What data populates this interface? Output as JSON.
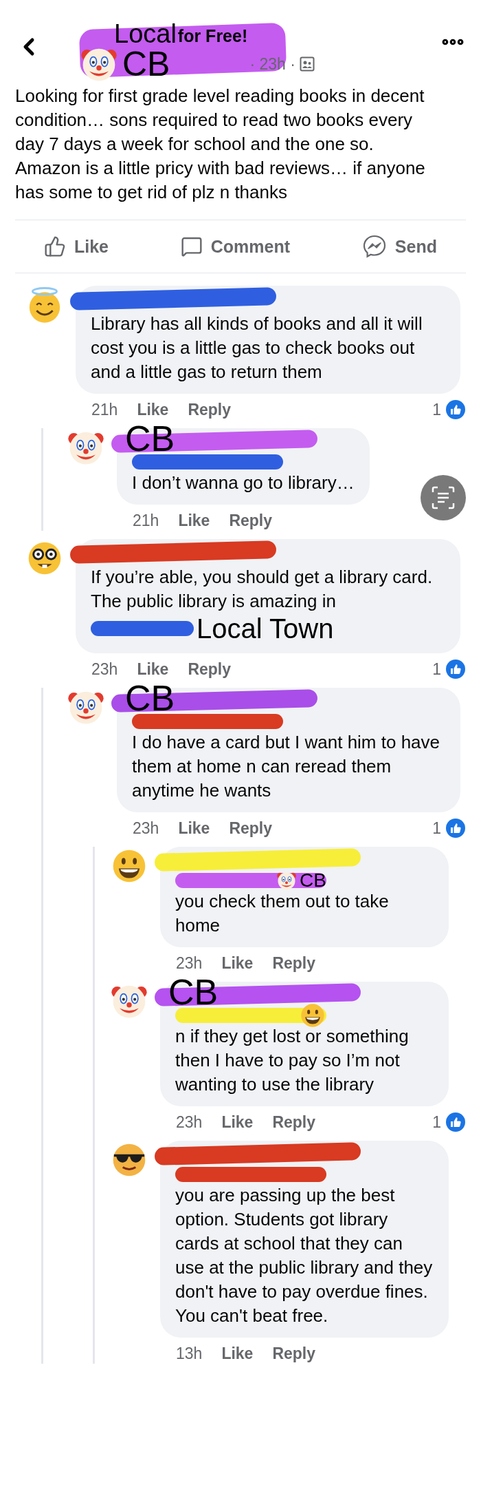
{
  "header": {
    "group_overlay": "Local",
    "group": "for Free!",
    "author_overlay": "CB",
    "author_sticker": {
      "kind": "clown"
    },
    "meta": "· 23h ·"
  },
  "post": {
    "text": "Looking for first grade level reading books in decent condition… sons required to read two books every day 7 days a week for school and the one so. Amazon is a little pricy with bad reviews… if anyone has some to get rid of plz n thanks"
  },
  "actions": [
    {
      "kind": "like",
      "label": "Like"
    },
    {
      "kind": "comment",
      "label": "Comment"
    },
    {
      "kind": "send",
      "label": "Send"
    }
  ],
  "comments": [
    {
      "avatar": {
        "kind": "angel"
      },
      "name": {
        "color": "#2f5fe0"
      },
      "text": "Library has all kinds of books and all it will cost you is a little gas to check books out and a little gas to return them",
      "time": "21h",
      "like": "Like",
      "reply": "Reply",
      "reactions": "1",
      "children": [
        {
          "avatar": {
            "kind": "clown"
          },
          "name": {
            "color": "#c45cf0",
            "overlay": "CB"
          },
          "mention": {
            "color": "#2f5fe0"
          },
          "text": "I don’t wanna go to library…",
          "time": "21h",
          "like": "Like",
          "reply": "Reply"
        }
      ]
    },
    {
      "avatar": {
        "kind": "nerd"
      },
      "name": {
        "color": "#d83a22"
      },
      "text": "If you’re able, you should get a library card. The public library is amazing in",
      "place": {
        "color": "#2f5fe0",
        "overlay": "Local Town"
      },
      "time": "23h",
      "like": "Like",
      "reply": "Reply",
      "reactions": "1",
      "children": [
        {
          "avatar": {
            "kind": "clown"
          },
          "name": {
            "color": "#a94ee8",
            "overlay": "CB"
          },
          "mention": {
            "color": "#d83a22"
          },
          "text": "I do have a card but I want him to have them at home n can reread them anytime he wants",
          "time": "23h",
          "like": "Like",
          "reply": "Reply",
          "reactions": "1",
          "children": [
            {
              "avatar": {
                "kind": "grin"
              },
              "name": {
                "color": "#f7ee3a"
              },
              "mention": {
                "color": "#c45cf0",
                "sticker": {
                  "kind": "clown"
                },
                "overlay": "CB"
              },
              "text": "you check them out to take home",
              "time": "23h",
              "like": "Like",
              "reply": "Reply"
            },
            {
              "avatar": {
                "kind": "clown"
              },
              "name": {
                "color": "#b552f0",
                "overlay": "CB"
              },
              "mention": {
                "color": "#f7ee3a",
                "sticker": {
                  "kind": "grin"
                }
              },
              "text": "n if they get lost or something then I have to pay so I’m not wanting to use the library",
              "time": "23h",
              "like": "Like",
              "reply": "Reply",
              "reactions": "1"
            },
            {
              "avatar": {
                "kind": "cool"
              },
              "name": {
                "color": "#d83a22"
              },
              "mention": {
                "color": "#d83a22"
              },
              "text": "you are passing up the best option. Students got library cards at school that they can use at the public library and they don't have to pay overdue fines.  You can't beat free.",
              "time": "13h",
              "like": "Like",
              "reply": "Reply"
            }
          ]
        }
      ]
    }
  ]
}
